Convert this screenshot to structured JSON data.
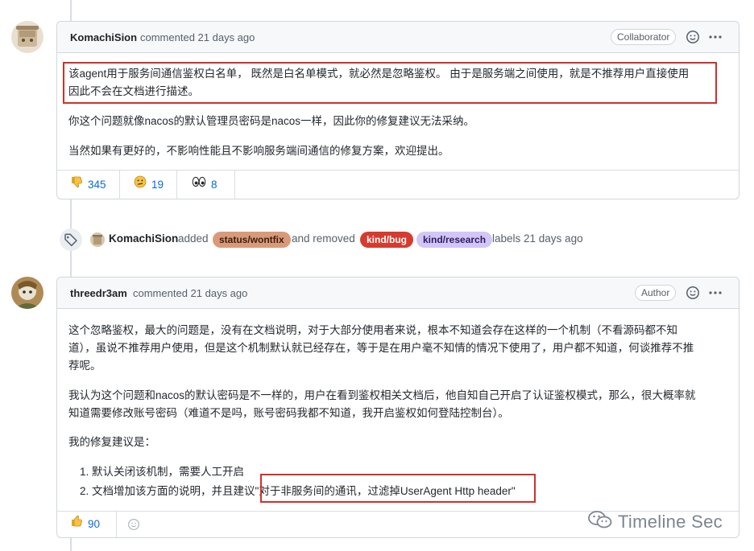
{
  "comment1": {
    "author": "KomachiSion",
    "action": "commented 21 days ago",
    "role": "Collaborator",
    "highlighted_line1": "该agent用于服务间通信鉴权白名单， 既然是白名单模式，就必然是忽略鉴权。 由于是服务端之间使用，就是不推荐用户直接使用",
    "highlighted_line2": "因此不会在文档进行描述。",
    "para2": "你这个问题就像nacos的默认管理员密码是nacos一样，因此你的修复建议无法采纳。",
    "para3": "当然如果有更好的，不影响性能且不影响服务端间通信的修复方案，欢迎提出。",
    "reactions": [
      {
        "emoji": "thumbs-down",
        "count": "345"
      },
      {
        "emoji": "confused",
        "count": "19"
      },
      {
        "emoji": "eyes",
        "count": "8"
      }
    ]
  },
  "event": {
    "actor": "KomachiSion",
    "added": "added",
    "and_removed": "and removed",
    "labels_text": "labels 21 days ago",
    "labels": [
      {
        "name": "status/wontfix",
        "bg": "#d99a7a",
        "fg": "#3a1e0f"
      },
      {
        "name": "kind/bug",
        "bg": "#d73a2e",
        "fg": "#ffffff"
      },
      {
        "name": "kind/research",
        "bg": "#d4c5f9",
        "fg": "#2b1d5a"
      }
    ]
  },
  "comment2": {
    "author": "threedr3am",
    "action": "commented 21 days ago",
    "role": "Author",
    "para1_line1": "这个忽略鉴权，最大的问题是，没有在文档说明，对于大部分使用者来说，根本不知道会存在这样的一个机制（不看源码都不知",
    "para1_line2": "道），虽说不推荐用户使用，但是这个机制默认就已经存在，等于是在用户毫不知情的情况下使用了，用户都不知道，何谈推荐不推",
    "para1_line3": "荐呢。",
    "para2_line1": "我认为这个问题和nacos的默认密码是不一样的，用户在看到鉴权相关文档后，他自知自己开启了认证鉴权模式，那么，很大概率就",
    "para2_line2": "知道需要修改账号密码（难道不是吗，账号密码我都不知道，我开启鉴权如何登陆控制台）。",
    "para3": "我的修复建议是：",
    "list": [
      {
        "num": "1.",
        "text": "默认关闭该机制，需要人工开启"
      },
      {
        "num": "2.",
        "text": "文档增加该方面的说明，并且建议",
        "highlight": "\"对于非服务间的通讯，过滤掉UserAgent Http header\""
      }
    ],
    "reactions": [
      {
        "emoji": "thumbs-up",
        "count": "90"
      }
    ]
  },
  "watermark": "Timeline Sec"
}
